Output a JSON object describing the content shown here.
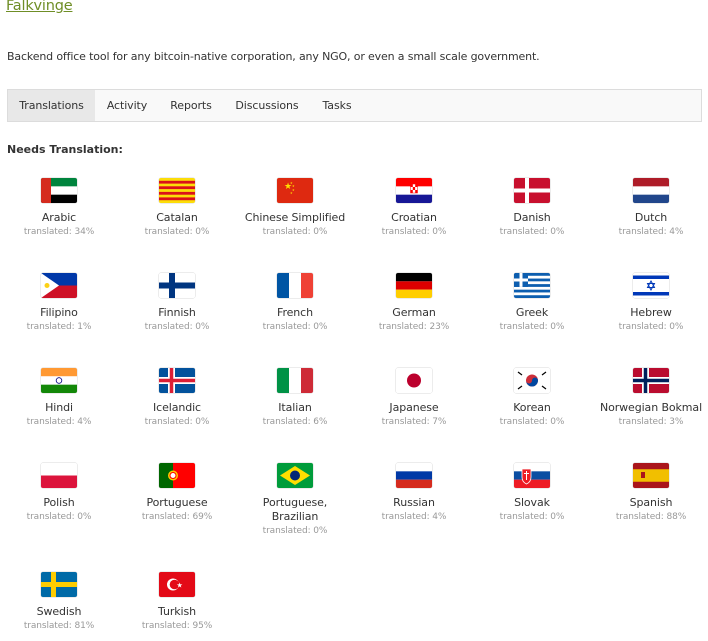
{
  "header": {
    "title": "Falkvinge",
    "description": "Backend office tool for any bitcoin-native corporation, any NGO, or even a small scale government."
  },
  "tabs": [
    {
      "label": "Translations",
      "active": true
    },
    {
      "label": "Activity"
    },
    {
      "label": "Reports"
    },
    {
      "label": "Discussions"
    },
    {
      "label": "Tasks"
    }
  ],
  "section_label": "Needs Translation:",
  "languages": [
    {
      "name": "Arabic",
      "status": "translated: 34%",
      "flag": "uae-flag-icon"
    },
    {
      "name": "Catalan",
      "status": "translated: 0%",
      "flag": "catalonia-flag-icon"
    },
    {
      "name": "Chinese Simplified",
      "status": "translated: 0%",
      "flag": "china-flag-icon"
    },
    {
      "name": "Croatian",
      "status": "translated: 0%",
      "flag": "croatia-flag-icon"
    },
    {
      "name": "Danish",
      "status": "translated: 0%",
      "flag": "denmark-flag-icon"
    },
    {
      "name": "Dutch",
      "status": "translated: 4%",
      "flag": "netherlands-flag-icon"
    },
    {
      "name": "Filipino",
      "status": "translated: 1%",
      "flag": "philippines-flag-icon"
    },
    {
      "name": "Finnish",
      "status": "translated: 0%",
      "flag": "finland-flag-icon"
    },
    {
      "name": "French",
      "status": "translated: 0%",
      "flag": "france-flag-icon"
    },
    {
      "name": "German",
      "status": "translated: 23%",
      "flag": "germany-flag-icon"
    },
    {
      "name": "Greek",
      "status": "translated: 0%",
      "flag": "greece-flag-icon"
    },
    {
      "name": "Hebrew",
      "status": "translated: 0%",
      "flag": "israel-flag-icon"
    },
    {
      "name": "Hindi",
      "status": "translated: 4%",
      "flag": "india-flag-icon"
    },
    {
      "name": "Icelandic",
      "status": "translated: 0%",
      "flag": "iceland-flag-icon"
    },
    {
      "name": "Italian",
      "status": "translated: 6%",
      "flag": "italy-flag-icon"
    },
    {
      "name": "Japanese",
      "status": "translated: 7%",
      "flag": "japan-flag-icon"
    },
    {
      "name": "Korean",
      "status": "translated: 0%",
      "flag": "south-korea-flag-icon"
    },
    {
      "name": "Norwegian Bokmal",
      "status": "translated: 3%",
      "flag": "norway-flag-icon"
    },
    {
      "name": "Polish",
      "status": "translated: 0%",
      "flag": "poland-flag-icon"
    },
    {
      "name": "Portuguese",
      "status": "translated: 69%",
      "flag": "portugal-flag-icon"
    },
    {
      "name": "Portuguese, Brazilian",
      "status": "translated: 0%",
      "flag": "brazil-flag-icon"
    },
    {
      "name": "Russian",
      "status": "translated: 4%",
      "flag": "russia-flag-icon"
    },
    {
      "name": "Slovak",
      "status": "translated: 0%",
      "flag": "slovakia-flag-icon"
    },
    {
      "name": "Spanish",
      "status": "translated: 88%",
      "flag": "spain-flag-icon"
    },
    {
      "name": "Swedish",
      "status": "translated: 81%",
      "flag": "sweden-flag-icon"
    },
    {
      "name": "Turkish",
      "status": "translated: 95%",
      "flag": "turkey-flag-icon"
    }
  ],
  "colors": {
    "link_green": "#6f8e26",
    "muted_text": "#999999",
    "active_tab_bg": "#e8e8e8"
  }
}
